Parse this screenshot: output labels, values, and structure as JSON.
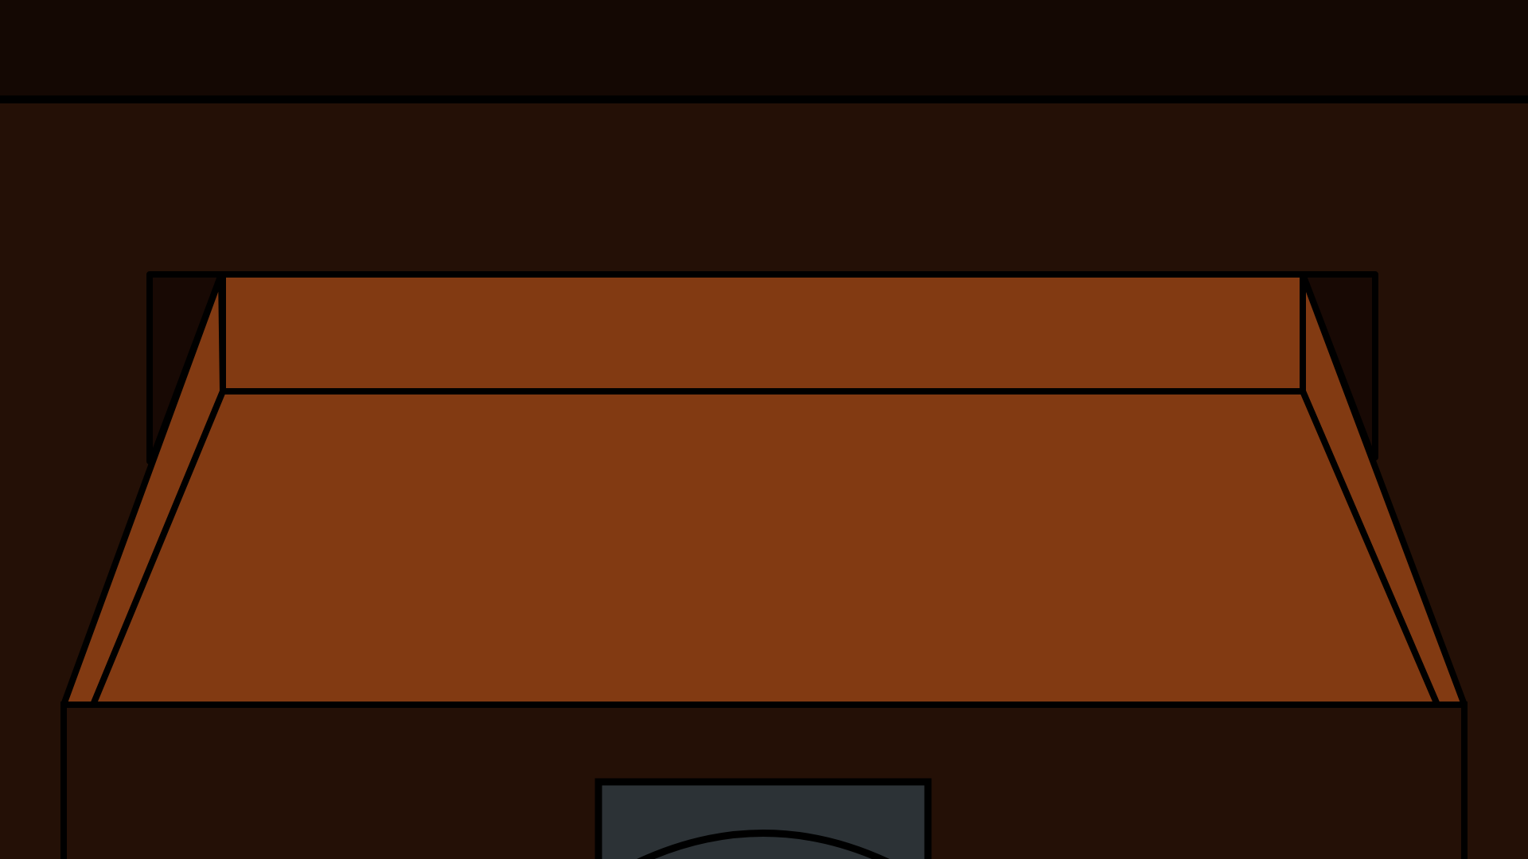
{
  "scene": {
    "description_name": "open-desk-drawer",
    "colors": {
      "wall_top": "#140803",
      "desk_body": "#241006",
      "drawer_interior": "#823a12",
      "drawer_shadow": "#180904",
      "handle_plate": "#2c3236",
      "outline": "#000000"
    },
    "icons": [
      "drawer-handle-icon"
    ]
  }
}
